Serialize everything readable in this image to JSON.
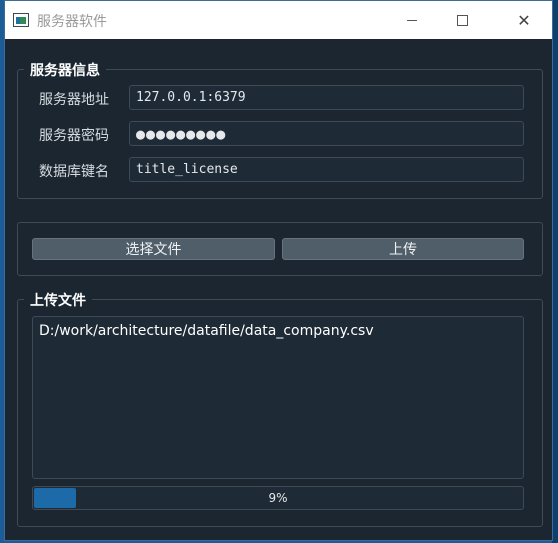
{
  "window": {
    "title": "服务器软件",
    "close_glyph": "✕"
  },
  "server_info": {
    "group_title": "服务器信息",
    "address_label": "服务器地址",
    "address_value": "127.0.0.1:6379",
    "password_label": "服务器密码",
    "password_value": "●●●●●●●●●",
    "db_key_label": "数据库键名",
    "db_key_value": "title_license"
  },
  "actions": {
    "select_file_label": "选择文件",
    "upload_label": "上传"
  },
  "upload": {
    "group_title": "上传文件",
    "file_path": "D:/work/architecture/datafile/data_company.csv",
    "progress_percent": 9,
    "progress_text": "9%"
  },
  "colors": {
    "window_bg": "#1b2631",
    "accent": "#1d6aa8",
    "button_bg": "#505e69"
  }
}
